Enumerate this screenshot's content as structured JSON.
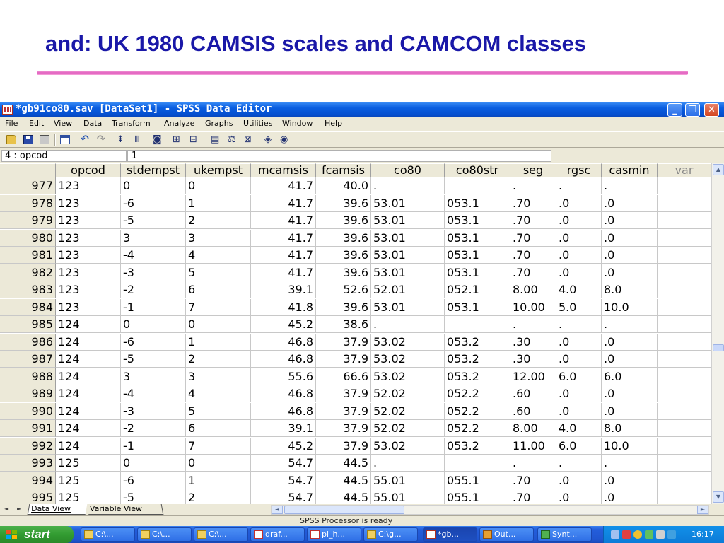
{
  "slide": {
    "title": "and: UK 1980 CAMSIS scales and CAMCOM classes"
  },
  "window": {
    "title": "*gb91co80.sav [DataSet1] - SPSS Data Editor",
    "minimize": "_",
    "maximize": "❐",
    "close": "✕"
  },
  "menu": [
    "File",
    "Edit",
    "View",
    "Data",
    "Transform",
    "Analyze",
    "Graphs",
    "Utilities",
    "Window",
    "Help"
  ],
  "toolbar_icons": [
    "open-icon",
    "save-icon",
    "print-icon",
    "dialog-recall-icon",
    "undo-icon",
    "redo-icon",
    "goto-case-icon",
    "variables-icon",
    "find-icon",
    "insert-case-icon",
    "insert-variable-icon",
    "split-file-icon",
    "weight-cases-icon",
    "select-cases-icon",
    "value-labels-icon",
    "use-sets-icon"
  ],
  "cell_editor": {
    "reference": "4 : opcod",
    "value": "1"
  },
  "grid": {
    "columns": [
      "opcod",
      "stdempst",
      "ukempst",
      "mcamsis",
      "fcamsis",
      "co80",
      "co80str",
      "seg",
      "rgsc",
      "casmin",
      "var"
    ],
    "rows": [
      {
        "n": "977",
        "cells": [
          "123",
          "0",
          "0",
          "41.7",
          "40.0",
          ".",
          "",
          ".",
          ".",
          "."
        ]
      },
      {
        "n": "978",
        "cells": [
          "123",
          "-6",
          "1",
          "41.7",
          "39.6",
          "53.01",
          "053.1",
          ".70",
          ".0",
          ".0"
        ]
      },
      {
        "n": "979",
        "cells": [
          "123",
          "-5",
          "2",
          "41.7",
          "39.6",
          "53.01",
          "053.1",
          ".70",
          ".0",
          ".0"
        ]
      },
      {
        "n": "980",
        "cells": [
          "123",
          "3",
          "3",
          "41.7",
          "39.6",
          "53.01",
          "053.1",
          ".70",
          ".0",
          ".0"
        ]
      },
      {
        "n": "981",
        "cells": [
          "123",
          "-4",
          "4",
          "41.7",
          "39.6",
          "53.01",
          "053.1",
          ".70",
          ".0",
          ".0"
        ]
      },
      {
        "n": "982",
        "cells": [
          "123",
          "-3",
          "5",
          "41.7",
          "39.6",
          "53.01",
          "053.1",
          ".70",
          ".0",
          ".0"
        ]
      },
      {
        "n": "983",
        "cells": [
          "123",
          "-2",
          "6",
          "39.1",
          "52.6",
          "52.01",
          "052.1",
          "8.00",
          "4.0",
          "8.0"
        ]
      },
      {
        "n": "984",
        "cells": [
          "123",
          "-1",
          "7",
          "41.8",
          "39.6",
          "53.01",
          "053.1",
          "10.00",
          "5.0",
          "10.0"
        ]
      },
      {
        "n": "985",
        "cells": [
          "124",
          "0",
          "0",
          "45.2",
          "38.6",
          ".",
          "",
          ".",
          ".",
          "."
        ]
      },
      {
        "n": "986",
        "cells": [
          "124",
          "-6",
          "1",
          "46.8",
          "37.9",
          "53.02",
          "053.2",
          ".30",
          ".0",
          ".0"
        ]
      },
      {
        "n": "987",
        "cells": [
          "124",
          "-5",
          "2",
          "46.8",
          "37.9",
          "53.02",
          "053.2",
          ".30",
          ".0",
          ".0"
        ]
      },
      {
        "n": "988",
        "cells": [
          "124",
          "3",
          "3",
          "55.6",
          "66.6",
          "53.02",
          "053.2",
          "12.00",
          "6.0",
          "6.0"
        ]
      },
      {
        "n": "989",
        "cells": [
          "124",
          "-4",
          "4",
          "46.8",
          "37.9",
          "52.02",
          "052.2",
          ".60",
          ".0",
          ".0"
        ]
      },
      {
        "n": "990",
        "cells": [
          "124",
          "-3",
          "5",
          "46.8",
          "37.9",
          "52.02",
          "052.2",
          ".60",
          ".0",
          ".0"
        ]
      },
      {
        "n": "991",
        "cells": [
          "124",
          "-2",
          "6",
          "39.1",
          "37.9",
          "52.02",
          "052.2",
          "8.00",
          "4.0",
          "8.0"
        ]
      },
      {
        "n": "992",
        "cells": [
          "124",
          "-1",
          "7",
          "45.2",
          "37.9",
          "53.02",
          "053.2",
          "11.00",
          "6.0",
          "10.0"
        ]
      },
      {
        "n": "993",
        "cells": [
          "125",
          "0",
          "0",
          "54.7",
          "44.5",
          ".",
          "",
          ".",
          ".",
          "."
        ]
      },
      {
        "n": "994",
        "cells": [
          "125",
          "-6",
          "1",
          "54.7",
          "44.5",
          "55.01",
          "055.1",
          ".70",
          ".0",
          ".0"
        ]
      },
      {
        "n": "995",
        "cells": [
          "125",
          "-5",
          "2",
          "54.7",
          "44.5",
          "55.01",
          "055.1",
          ".70",
          ".0",
          ".0"
        ]
      }
    ]
  },
  "tabs": {
    "data_view": "Data View",
    "variable_view": "Variable View"
  },
  "status": "SPSS Processor is ready",
  "taskbar": {
    "start": "start",
    "tasks": [
      "C:\\...",
      "C:\\...",
      "C:\\...",
      "draf...",
      "pl_h...",
      "C:\\g...",
      "*gb...",
      "Out...",
      "Synt..."
    ],
    "clock": "16:17"
  },
  "colors": {
    "title_blue": "#1a18a8",
    "accent_pink": "#e060c0",
    "xp_blue": "#0a5ee0"
  }
}
